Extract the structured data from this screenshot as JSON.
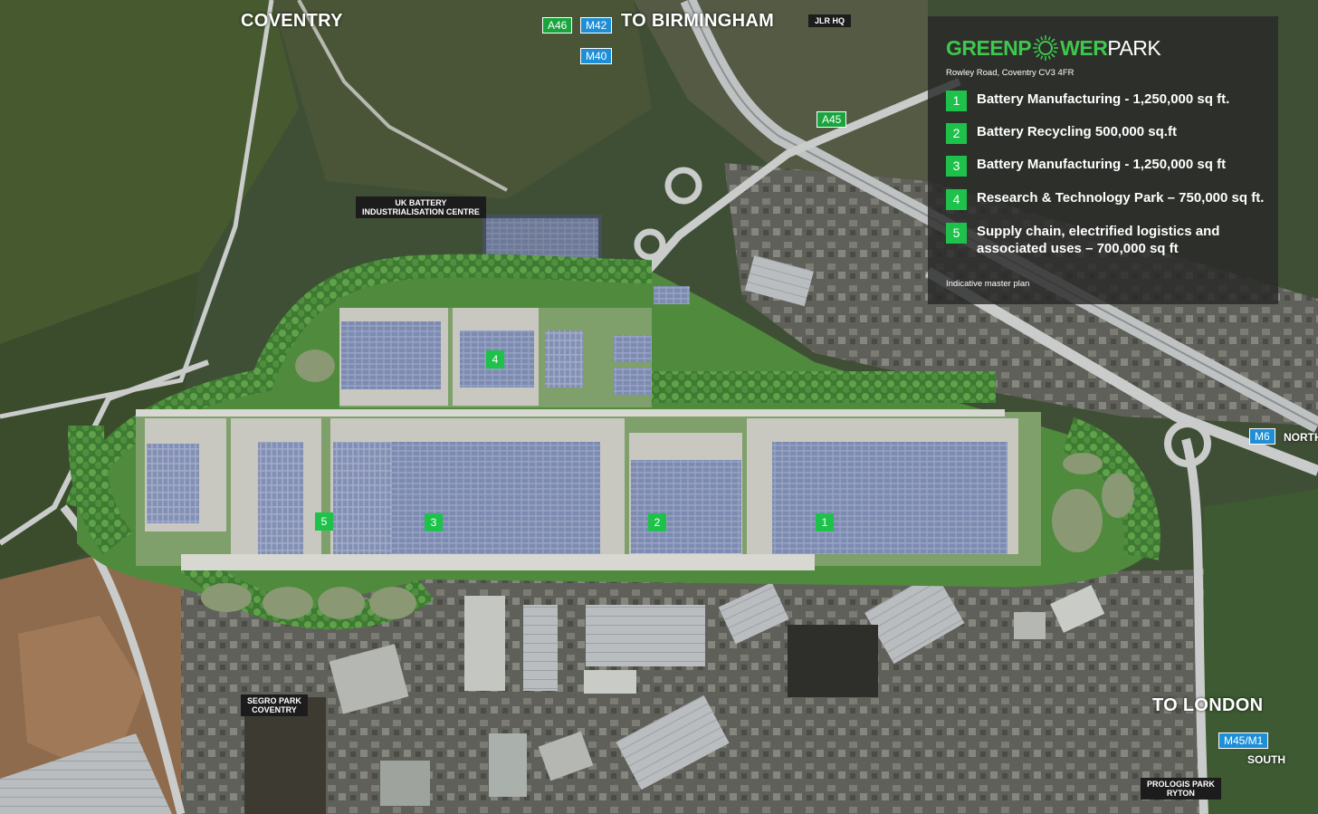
{
  "map": {
    "cities": {
      "coventry": "COVENTRY",
      "to_birmingham": "TO BIRMINGHAM",
      "to_london": "TO LONDON"
    },
    "directions": {
      "north": "NORTH",
      "south": "SOUTH"
    },
    "road_markers": {
      "a46": "A46",
      "m42": "M42",
      "m40": "M40",
      "a45": "A45",
      "m6": "M6",
      "m45_m1": "M45/M1"
    },
    "place_tags": {
      "jlr_hq": "JLR HQ",
      "ukbic_line1": "UK BATTERY",
      "ukbic_line2": "INDUSTRIALISATION CENTRE",
      "segro_line1": "SEGRO PARK",
      "segro_line2": "COVENTRY",
      "prologis_line1": "PROLOGIS PARK",
      "prologis_line2": "RYTON"
    },
    "plot_markers": [
      "1",
      "2",
      "3",
      "4",
      "5"
    ],
    "colors": {
      "accent_green": "#1ec24a",
      "motorway_blue": "#1e8fd6",
      "a_road_green": "#17a53c",
      "logo_green": "#3ec84c"
    }
  },
  "legend": {
    "logo_part1": "GREENP",
    "logo_part2": "WER",
    "logo_part3": "PARK",
    "address": "Rowley Road, Coventry CV3 4FR",
    "items": [
      {
        "num": "1",
        "line1": "Battery Manufacturing - 1,250,000 sq ft.",
        "line2": ""
      },
      {
        "num": "2",
        "line1": "Battery Recycling 500,000 sq.ft",
        "line2": ""
      },
      {
        "num": "3",
        "line1": "Battery Manufacturing - 1,250,000 sq ft",
        "line2": ""
      },
      {
        "num": "4",
        "line1": "Research & Technology Park – 750,000 sq ft.",
        "line2": ""
      },
      {
        "num": "5",
        "line1": "Supply chain, electrified logistics and",
        "line2": "associated uses – 700,000 sq ft"
      }
    ],
    "note": "Indicative master plan"
  }
}
